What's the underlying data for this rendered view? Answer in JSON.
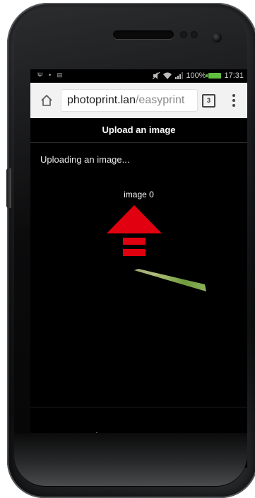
{
  "status_bar": {
    "notification_icons": "Ψ • ⊟",
    "battery_percent": "100%",
    "time": "17:31",
    "battery_color": "#5fbf3f"
  },
  "browser": {
    "url_domain": "photoprint.lan",
    "url_path": "/easyprint",
    "tab_count": "3",
    "toolbar_bg": "#f2f2f2"
  },
  "page": {
    "header_title": "Upload an image",
    "status_text": "Uploading an image...",
    "image_label": "image 0",
    "arrow_color": "#e1000f",
    "background": "#000000"
  },
  "nav": {
    "icons": [
      "back-icon",
      "home-icon",
      "recents-icon"
    ]
  }
}
